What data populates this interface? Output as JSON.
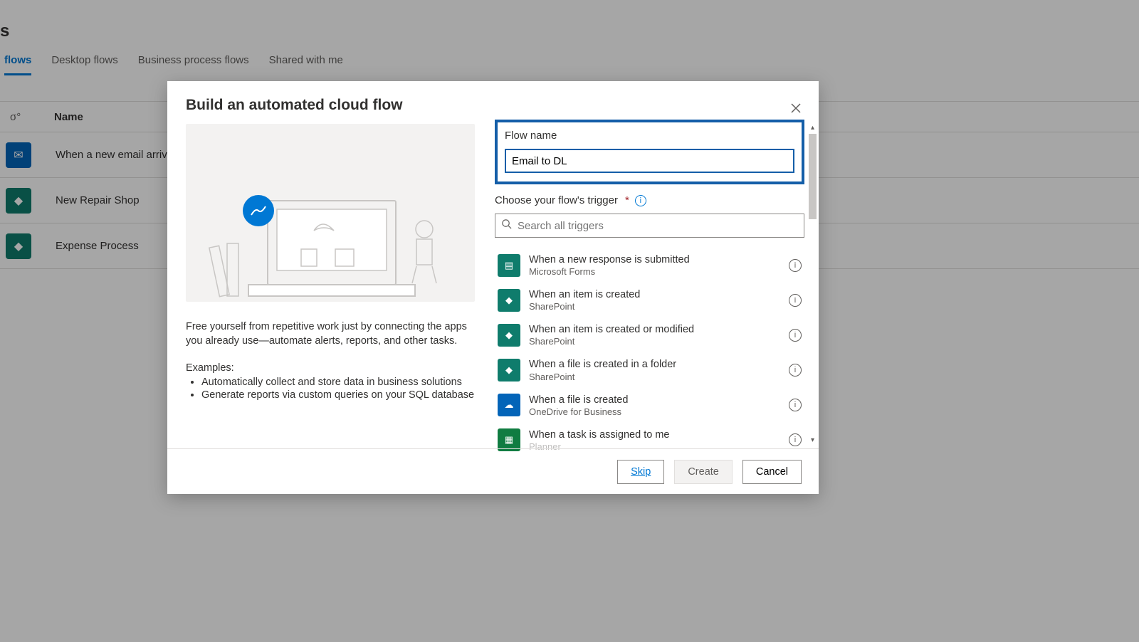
{
  "bg": {
    "partial_header": "s",
    "tabs": [
      "flows",
      "Desktop flows",
      "Business process flows",
      "Shared with me"
    ],
    "columns": {
      "type_icon": "σ°",
      "name": "Name"
    },
    "rows": [
      {
        "icon": "blue",
        "glyph": "✉",
        "name": "When a new email arrives"
      },
      {
        "icon": "teal",
        "glyph": "◆",
        "name": "New Repair Shop"
      },
      {
        "icon": "teal",
        "glyph": "◆",
        "name": "Expense Process"
      }
    ]
  },
  "modal": {
    "title": "Build an automated cloud flow",
    "flowname_label": "Flow name",
    "flowname_value": "Email to DL",
    "trigger_label": "Choose your flow's trigger",
    "search_placeholder": "Search all triggers",
    "info": "Free yourself from repetitive work just by connecting the apps you already use—automate alerts, reports, and other tasks.",
    "examples_label": "Examples:",
    "examples": [
      "Automatically collect and store data in business solutions",
      "Generate reports via custom queries on your SQL database"
    ],
    "triggers": [
      {
        "title": "When a new response is submitted",
        "sub": "Microsoft Forms",
        "kind": "forms"
      },
      {
        "title": "When an item is created",
        "sub": "SharePoint",
        "kind": "sp"
      },
      {
        "title": "When an item is created or modified",
        "sub": "SharePoint",
        "kind": "sp"
      },
      {
        "title": "When a file is created in a folder",
        "sub": "SharePoint",
        "kind": "sp"
      },
      {
        "title": "When a file is created",
        "sub": "OneDrive for Business",
        "kind": "od"
      },
      {
        "title": "When a task is assigned to me",
        "sub": "Planner",
        "kind": "pl"
      }
    ],
    "footer": {
      "skip": "Skip",
      "create": "Create",
      "cancel": "Cancel"
    }
  }
}
